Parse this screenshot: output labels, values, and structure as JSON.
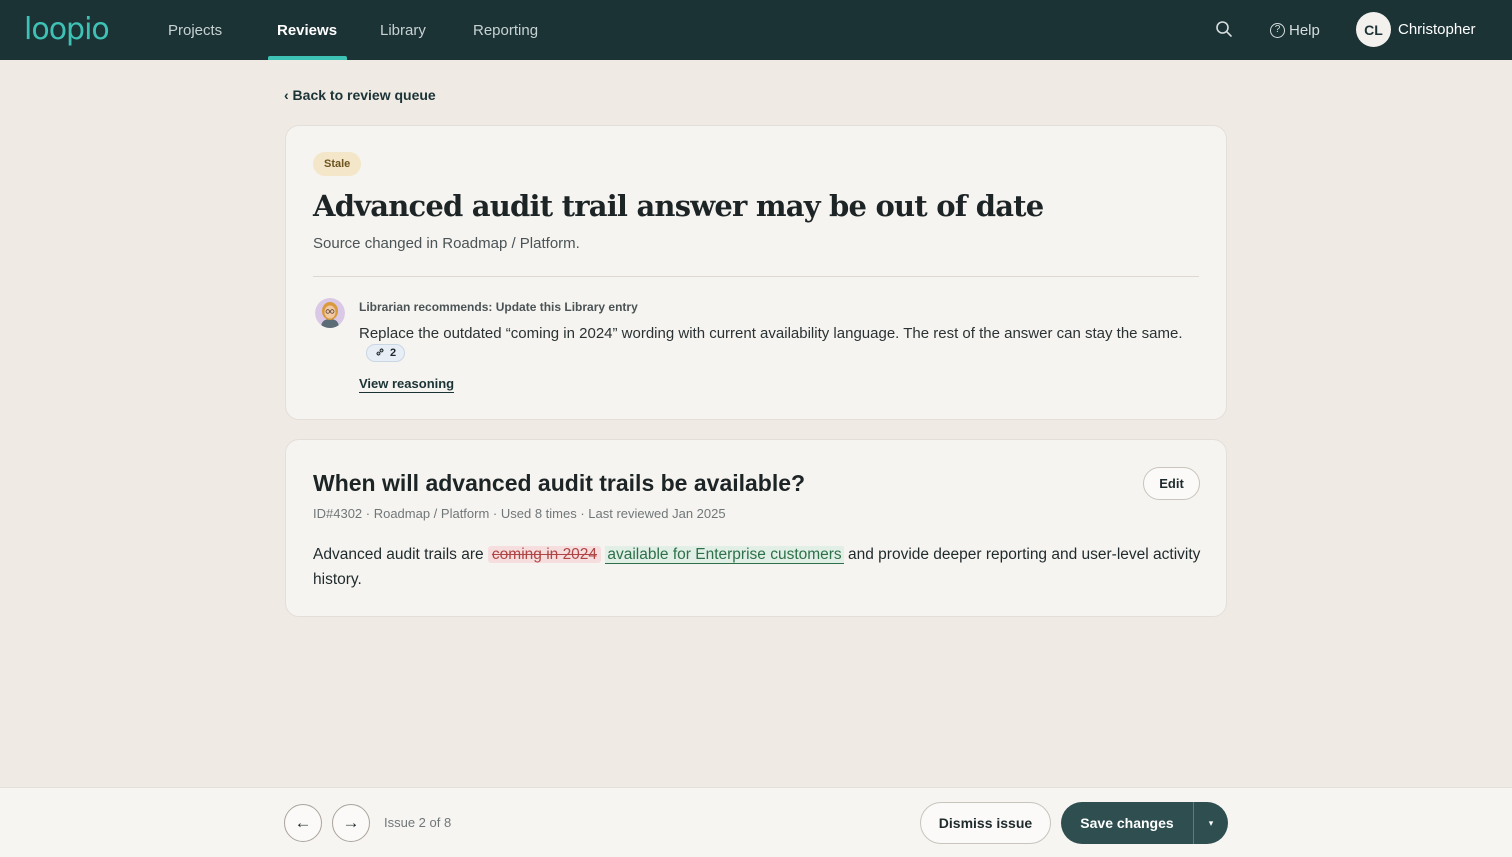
{
  "nav": {
    "logo": "loopio",
    "items": [
      {
        "label": "Projects",
        "active": false
      },
      {
        "label": "Reviews",
        "active": true
      },
      {
        "label": "Library",
        "active": false
      },
      {
        "label": "Reporting",
        "active": false
      }
    ],
    "help_label": "Help",
    "user": {
      "initials": "CL",
      "name": "Christopher"
    }
  },
  "back_link": "‹ Back to review queue",
  "issue": {
    "badge": "Stale",
    "title": "Advanced audit trail answer may be out of date",
    "subtitle": "Source changed in Roadmap / Platform.",
    "recommendation": {
      "heading": "Librarian recommends: Update this Library entry",
      "body": "Replace the outdated “coming in 2024” wording with current availability language. The rest of the answer can stay the same.",
      "citation_count": "2",
      "view_reasoning": "View reasoning"
    }
  },
  "entry": {
    "question": "When will advanced audit trails be available?",
    "edit_label": "Edit",
    "meta": "ID#4302 · Roadmap / Platform · Used 8 times · Last reviewed Jan 2025",
    "answer": {
      "prefix": "Advanced audit trails are",
      "removed": "coming in 2024",
      "added": "available for Enterprise customers",
      "suffix": "and provide deeper reporting and user-level activity history."
    }
  },
  "footer": {
    "prev_icon": "←",
    "next_icon": "→",
    "issue_count": "Issue 2 of 8",
    "dismiss_label": "Dismiss issue",
    "save_label": "Save changes",
    "save_menu_icon": "▾"
  },
  "icons": {
    "search": "search-icon",
    "help": "help-icon",
    "link": "link-icon",
    "arrow_left": "arrow-left-icon",
    "arrow_right": "arrow-right-icon",
    "caret": "chevron-down-icon"
  },
  "colors": {
    "nav_bg": "#1c3336",
    "accent": "#3fc2b6",
    "page_bg": "#efeae4",
    "primary_button": "#2e4e50",
    "badge_bg": "#f4e6c8",
    "removed_text": "#b04545",
    "added_text": "#2d7049"
  }
}
